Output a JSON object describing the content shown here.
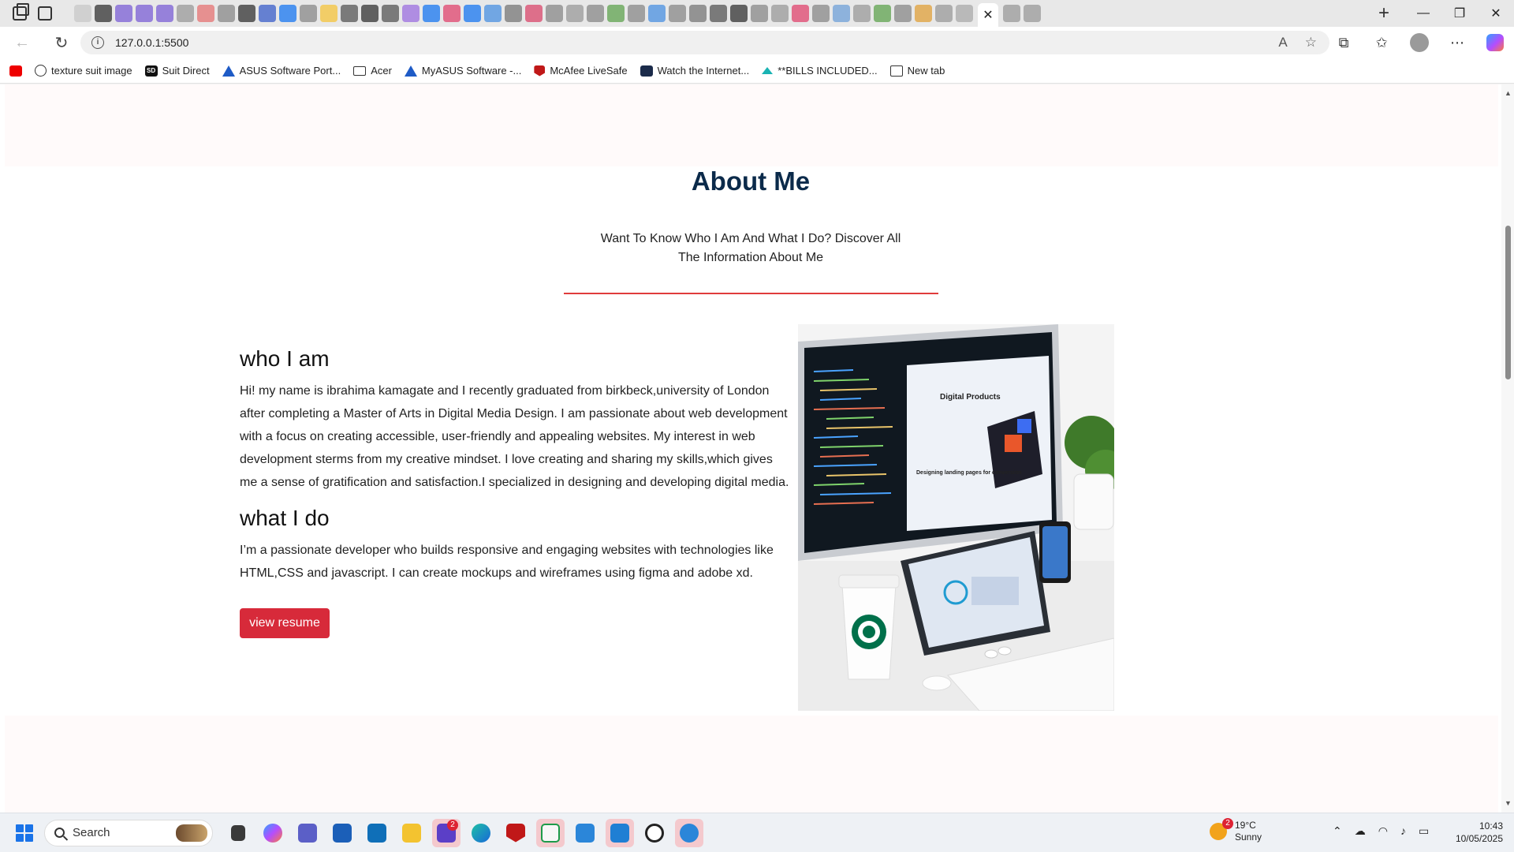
{
  "browser": {
    "url": "127.0.0.1:5500",
    "tab_close_glyph": "✕",
    "new_tab_glyph": "+",
    "win_minimize": "—",
    "win_restore": "❐",
    "win_close": "✕",
    "icons": [
      "back-arrow-icon",
      "refresh-icon",
      "info-icon",
      "read-aloud-icon",
      "favorite-star-icon",
      "extensions-icon",
      "favorites-icon",
      "profile-icon",
      "more-icon",
      "copilot-icon"
    ]
  },
  "bookmarks": [
    {
      "label": "",
      "icon": "youtube-icon"
    },
    {
      "label": "texture suit image",
      "icon": "globe-icon"
    },
    {
      "label": "Suit Direct",
      "icon": "sd-icon"
    },
    {
      "label": "ASUS Software Port...",
      "icon": "asus-icon"
    },
    {
      "label": "Acer",
      "icon": "folder-icon"
    },
    {
      "label": "MyASUS Software -...",
      "icon": "asus-icon"
    },
    {
      "label": "McAfee LiveSafe",
      "icon": "mcafee-icon"
    },
    {
      "label": "Watch the Internet...",
      "icon": "site-icon"
    },
    {
      "label": "**BILLS INCLUDED...",
      "icon": "house-icon"
    },
    {
      "label": "New tab",
      "icon": "page-icon"
    }
  ],
  "page": {
    "title": "About Me",
    "subtitle": "Want To Know Who I Am And What I Do? Discover All The Information About Me",
    "who_heading": "who I am",
    "who_text": "Hi! my name is ibrahima kamagate and I recently graduated from birkbeck,university of London after completing a Master of Arts in Digital Media Design. I am passionate about web development with a focus on creating accessible, user-friendly and appealing websites. My interest in web development sterms from my creative mindset. I love creating and sharing my skills,which gives me a sense of gratification and satisfaction.I specialized in designing and developing digital media.",
    "what_heading": "what I do",
    "what_text": "I’m a passionate developer who builds responsive and engaging websites with technologies like HTML,CSS and javascript. I can create mockups and wireframes using figma and adobe xd.",
    "button_label": "view resume",
    "photo_screen_heading": "Digital Products",
    "photo_screen_tagline": "Designing landing pages for conversion",
    "accent_color": "#d72a3a",
    "title_color": "#0b2a4a"
  },
  "taskbar": {
    "search_placeholder": "Search",
    "store_badge": "2",
    "weather_badge": "2",
    "temperature": "19°C",
    "condition": "Sunny",
    "time": "10:43",
    "date": "10/05/2025"
  }
}
